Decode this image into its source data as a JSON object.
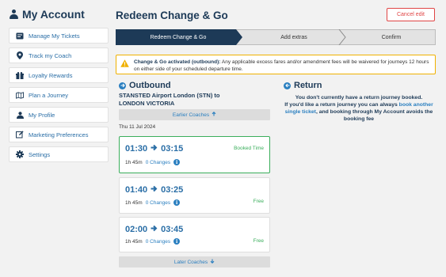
{
  "sidebar": {
    "title": "My Account",
    "items": [
      {
        "label": "Manage My Tickets",
        "icon": "ticket-icon"
      },
      {
        "label": "Track my Coach",
        "icon": "map-marker-icon"
      },
      {
        "label": "Loyalty Rewards",
        "icon": "gift-icon"
      },
      {
        "label": "Plan a Journey",
        "icon": "map-icon"
      },
      {
        "label": "My Profile",
        "icon": "user-icon"
      },
      {
        "label": "Marketing Preferences",
        "icon": "edit-icon"
      },
      {
        "label": "Settings",
        "icon": "gear-icon"
      }
    ]
  },
  "header": {
    "title": "Redeem Change & Go",
    "cancel_label": "Cancel edit"
  },
  "stepper": {
    "steps": [
      "Redeem Change & Go",
      "Add extras",
      "Confirm"
    ],
    "active_index": 0
  },
  "notice": {
    "bold": "Change & Go activated (outbound):",
    "text": " Any applicable excess fares and/or amendment fees will be waivered for journeys 12 hours on either side of your scheduled departure time."
  },
  "outbound": {
    "title": "Outbound",
    "from": "STANSTED Airport London (STN) to",
    "to": "LONDON VICTORIA",
    "earlier_label": "Earlier Coaches",
    "later_label": "Later Coaches",
    "date": "Thu 11 Jul 2024",
    "journeys": [
      {
        "depart": "01:30",
        "arrive": "03:15",
        "duration": "1h 45m",
        "changes": "0 Changes",
        "status": "Booked Time",
        "selected": true
      },
      {
        "depart": "01:40",
        "arrive": "03:25",
        "duration": "1h 45m",
        "changes": "0 Changes",
        "status": "Free",
        "selected": false
      },
      {
        "depart": "02:00",
        "arrive": "03:45",
        "duration": "1h 45m",
        "changes": "0 Changes",
        "status": "Free",
        "selected": false
      }
    ]
  },
  "return": {
    "title": "Return",
    "line1": "You don't currently have a return journey booked.",
    "line2a": "If you'd like a return journey you can always ",
    "link": "book another single ticket",
    "line2b": ", and booking through My Account avoids the booking fee"
  },
  "colors": {
    "navy": "#1d3a57",
    "link_blue": "#2a7fc0",
    "booked_green": "#3aae5b",
    "cancel_red": "#e04545",
    "warning_amber": "#f0b100"
  }
}
